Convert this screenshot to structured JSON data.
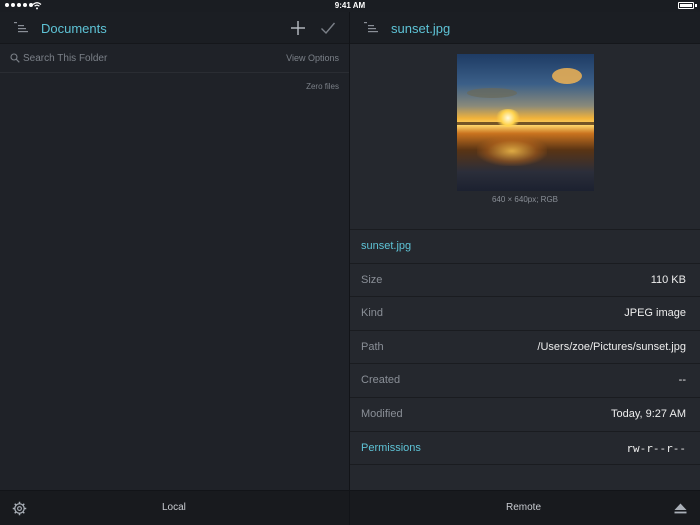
{
  "status_bar": {
    "time": "9:41 AM"
  },
  "left_pane": {
    "title": "Documents",
    "search": {
      "placeholder": "Search This Folder",
      "value": ""
    },
    "view_options_label": "View Options",
    "file_count_label": "Zero files"
  },
  "right_pane": {
    "title": "sunset.jpg",
    "image_info": "640 × 640px; RGB",
    "rows": [
      {
        "label": "sunset.jpg",
        "value": ""
      },
      {
        "label": "Size",
        "value": "110 KB"
      },
      {
        "label": "Kind",
        "value": "JPEG image"
      },
      {
        "label": "Path",
        "value": "/Users/zoe/Pictures/sunset.jpg"
      },
      {
        "label": "Created",
        "value": "--"
      },
      {
        "label": "Modified",
        "value": "Today, 9:27 AM"
      },
      {
        "label": "Permissions",
        "value": "rw-r--r--"
      }
    ]
  },
  "bottom_bar": {
    "left_label": "Local",
    "right_label": "Remote"
  },
  "colors": {
    "accent": "#5ec3d6",
    "background": "#1f2228",
    "panel": "#25282e",
    "text": "#ededed",
    "muted": "#8a8f97"
  },
  "icons": [
    "list-icon",
    "plus-icon",
    "checkmark-icon",
    "search-icon",
    "gear-icon",
    "eject-icon",
    "wifi-icon",
    "battery-icon",
    "signal-icon"
  ]
}
